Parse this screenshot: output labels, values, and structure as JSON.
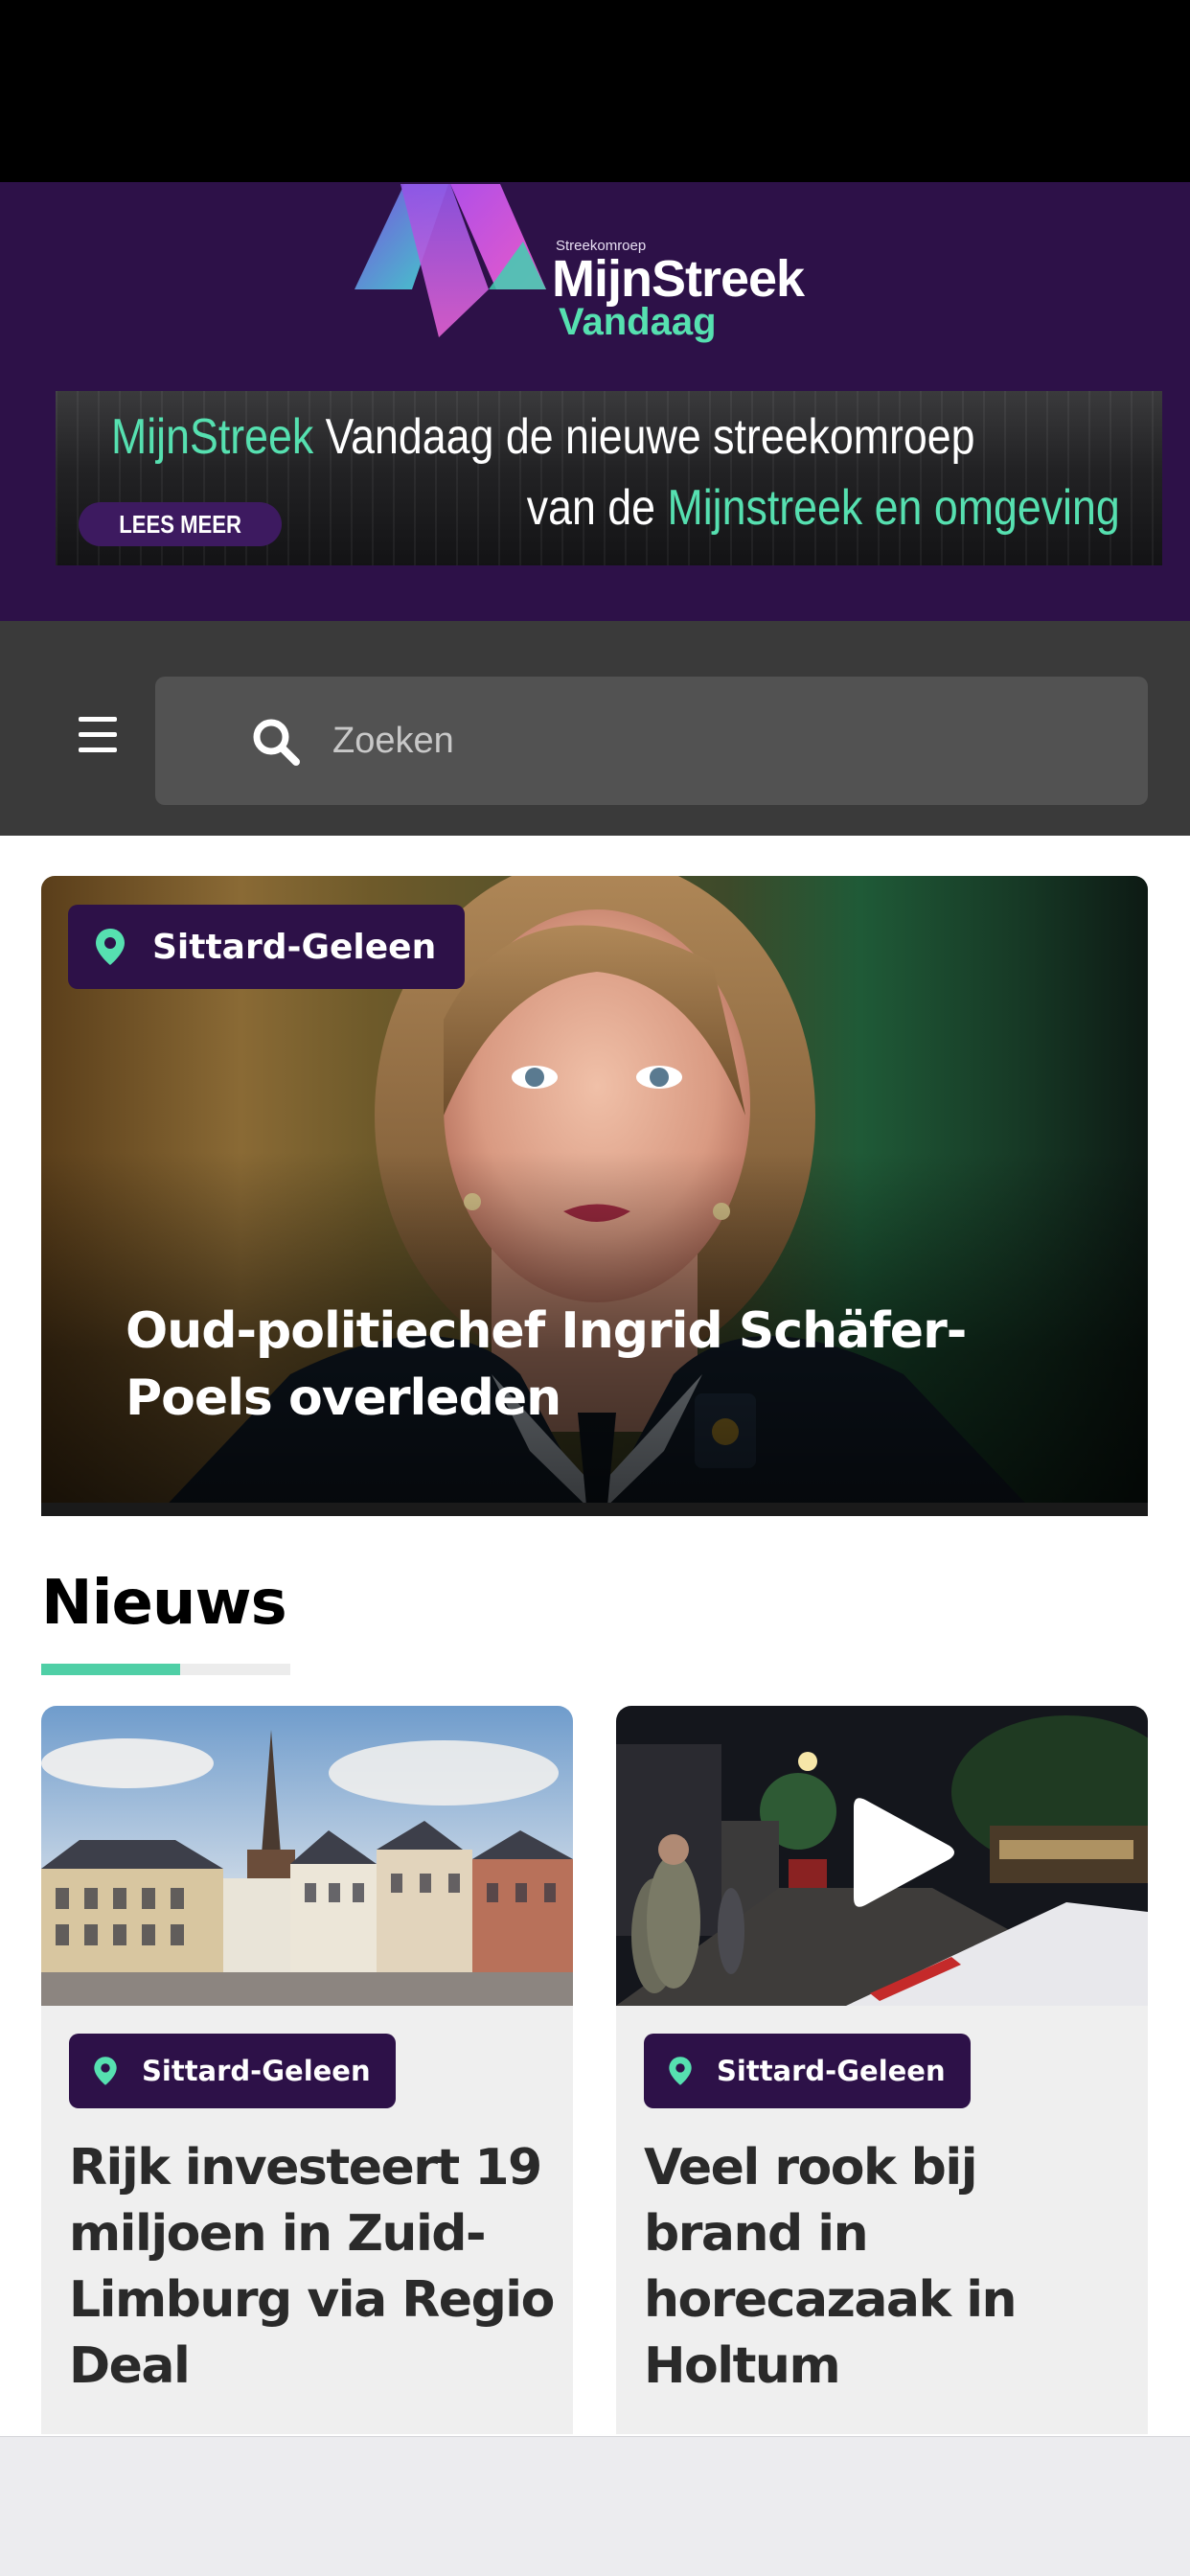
{
  "header": {
    "logo": {
      "tagline": "Streekomroep",
      "name": "MijnStreek",
      "subname": "Vandaag"
    },
    "banner": {
      "line1_accent": "MijnStreek",
      "line1_rest": " Vandaag de nieuwe streekomroep",
      "line2_rest": "van de ",
      "line2_accent": "Mijnstreek en omgeving",
      "button_label": "LEES MEER"
    }
  },
  "nav": {
    "menu_icon": "hamburger-menu-icon",
    "search_icon": "search-icon",
    "search_placeholder": "Zoeken"
  },
  "featured": {
    "location": "Sittard-Geleen",
    "title": "Oud-politiechef Ingrid Schäfer-Poels overleden"
  },
  "news": {
    "section_title": "Nieuws",
    "articles": [
      {
        "location": "Sittard-Geleen",
        "title": "Rijk investeert 19 miljoen in Zuid-Limburg via Regio Deal",
        "has_video": false
      },
      {
        "location": "Sittard-Geleen",
        "title": "Veel rook bij brand in horecazaak in Holtum",
        "has_video": true
      }
    ]
  },
  "colors": {
    "brand_purple": "#2d1148",
    "accent_green": "#56e0b0",
    "nav_grey": "#3a3a3a",
    "search_grey": "#525252",
    "card_bg": "#efefef"
  }
}
